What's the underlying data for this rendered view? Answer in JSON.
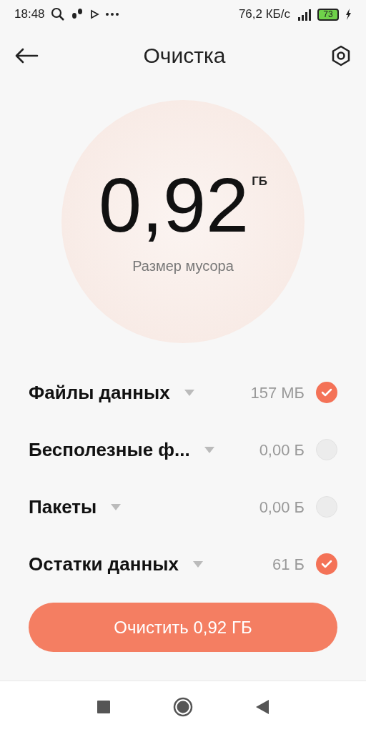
{
  "status_bar": {
    "time": "18:48",
    "speed": "76,2 КБ/с",
    "battery": "73"
  },
  "header": {
    "title": "Очистка"
  },
  "summary": {
    "value": "0,92",
    "unit": "ГБ",
    "caption": "Размер мусора"
  },
  "items": [
    {
      "label": "Файлы данных",
      "size": "157 МБ",
      "checked": true
    },
    {
      "label": "Бесполезные ф...",
      "size": "0,00 Б",
      "checked": false
    },
    {
      "label": "Пакеты",
      "size": "0,00 Б",
      "checked": false
    },
    {
      "label": "Остатки данных",
      "size": "61 Б",
      "checked": true
    }
  ],
  "action_button": {
    "label": "Очистить 0,92 ГБ"
  }
}
